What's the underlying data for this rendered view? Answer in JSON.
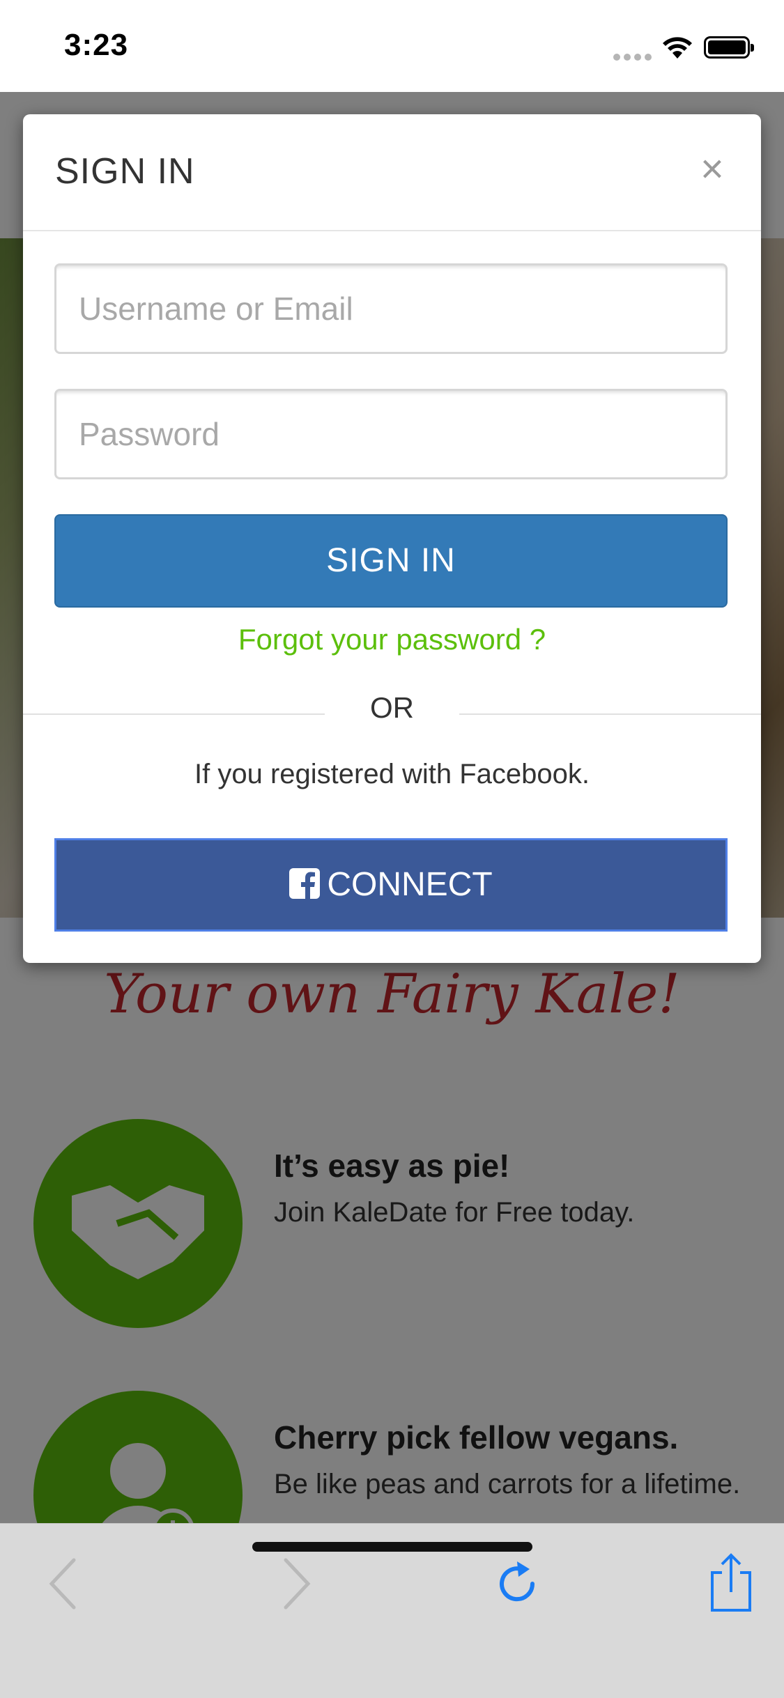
{
  "status_bar": {
    "time": "3:23"
  },
  "page": {
    "tagline": "Your own Fairy Kale!",
    "features": [
      {
        "title": "It’s easy as pie!",
        "desc": "Join KaleDate for Free today."
      },
      {
        "title": "Cherry pick fellow vegans.",
        "desc": "Be like peas and carrots for a lifetime."
      }
    ]
  },
  "modal": {
    "title": "SIGN IN",
    "close_symbol": "×",
    "username_placeholder": "Username or Email",
    "password_placeholder": "Password",
    "signin_button": "SIGN IN",
    "forgot_link": "Forgot your password ?",
    "or_text": "OR",
    "facebook_note": "If you registered with Facebook.",
    "connect_button": "CONNECT"
  },
  "colors": {
    "primary": "#337ab7",
    "facebook": "#3b5998",
    "accent_green": "#5cbf0c",
    "tagline_red": "#c0262c"
  },
  "toolbar": {
    "icons": [
      "back-icon",
      "forward-icon",
      "reload-icon",
      "share-icon"
    ]
  }
}
